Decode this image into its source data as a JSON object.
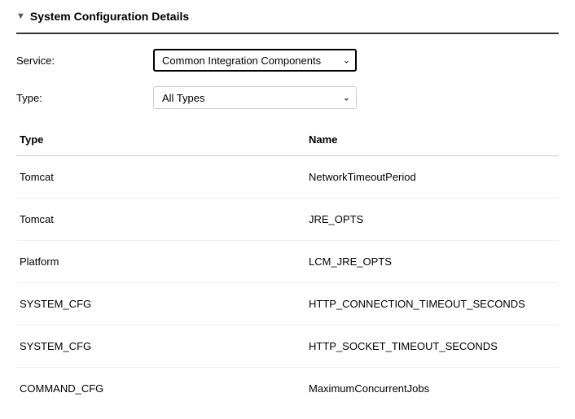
{
  "section": {
    "title": "System Configuration Details"
  },
  "filters": {
    "service": {
      "label": "Service:",
      "value": "Common Integration Components"
    },
    "type": {
      "label": "Type:",
      "value": "All Types"
    }
  },
  "table": {
    "headers": {
      "type": "Type",
      "name": "Name"
    },
    "rows": [
      {
        "type": "Tomcat",
        "name": "NetworkTimeoutPeriod"
      },
      {
        "type": "Tomcat",
        "name": "JRE_OPTS"
      },
      {
        "type": "Platform",
        "name": "LCM_JRE_OPTS"
      },
      {
        "type": "SYSTEM_CFG",
        "name": "HTTP_CONNECTION_TIMEOUT_SECONDS"
      },
      {
        "type": "SYSTEM_CFG",
        "name": "HTTP_SOCKET_TIMEOUT_SECONDS"
      },
      {
        "type": "COMMAND_CFG",
        "name": "MaximumConcurrentJobs"
      }
    ]
  }
}
